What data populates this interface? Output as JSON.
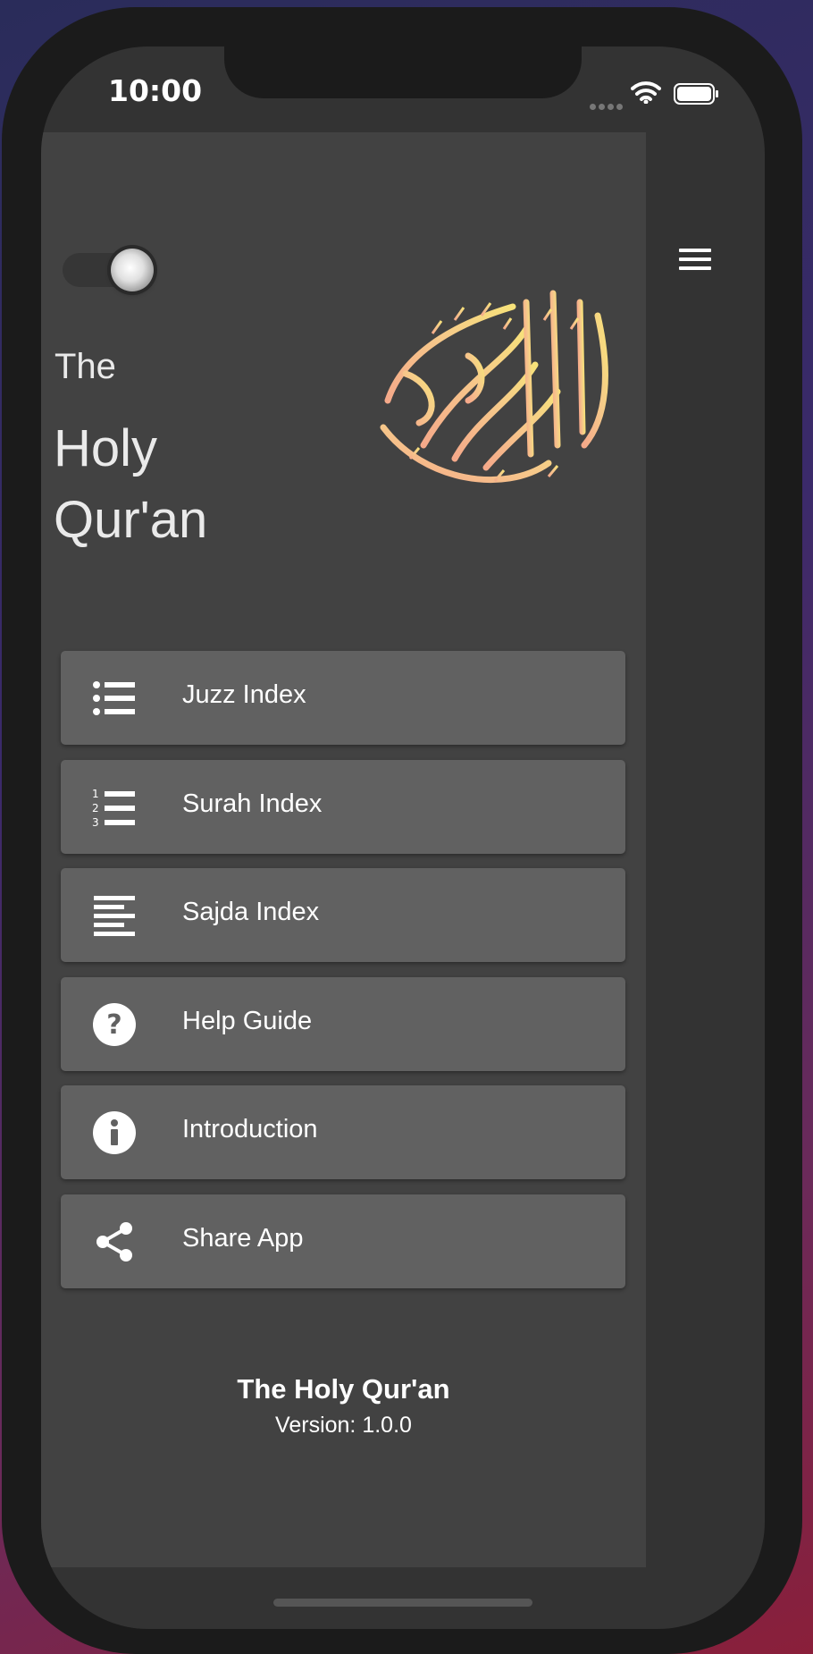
{
  "status_bar": {
    "time": "10:00"
  },
  "drawer": {
    "title_line1": "The",
    "title_line2": "Holy",
    "title_line3": "Qur'an",
    "menu": [
      {
        "label": "Juzz Index",
        "icon": "list-bullet-icon"
      },
      {
        "label": "Surah Index",
        "icon": "list-numbered-icon"
      },
      {
        "label": "Sajda Index",
        "icon": "align-left-icon"
      },
      {
        "label": "Help Guide",
        "icon": "help-circle-icon"
      },
      {
        "label": "Introduction",
        "icon": "info-circle-icon"
      },
      {
        "label": "Share App",
        "icon": "share-icon"
      }
    ],
    "footer": {
      "app_name": "The Holy Qur'an",
      "version": "Version: 1.0.0"
    }
  },
  "theme": {
    "drawer_bg": "#424242",
    "menu_item_bg": "#616161",
    "screen_bg": "#333333",
    "calligraphy_gradient": [
      "#f5a98a",
      "#f7e27a"
    ]
  }
}
